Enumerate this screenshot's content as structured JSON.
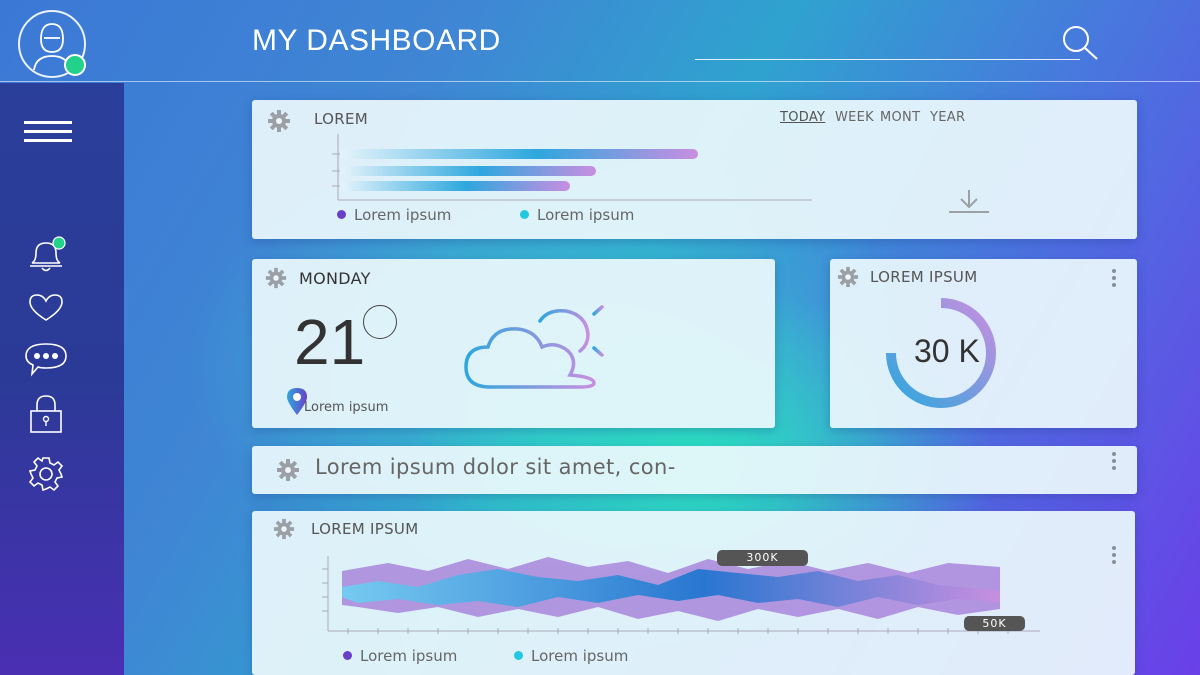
{
  "header": {
    "title": "MY DASHBOARD"
  },
  "icons": {
    "avatar": "user-avatar",
    "search": "search-icon",
    "menu": "hamburger-menu-icon",
    "notifications": "bell-icon",
    "favorites": "heart-icon",
    "messages": "chat-bubble-icon",
    "security": "lock-icon",
    "settings": "gear-icon",
    "download": "download-icon",
    "location": "location-pin-icon",
    "weather": "partly-cloudy-icon"
  },
  "colors": {
    "online_status": "#22d18a",
    "legend_purple": "#6a3fc8",
    "legend_cyan": "#22c7e0",
    "sidebar": "#2a3f9a"
  },
  "bar_card": {
    "label": "LOREM",
    "tabs": [
      {
        "label": "TODAY",
        "active": true
      },
      {
        "label": "WEEK",
        "active": false
      },
      {
        "label": "MONT",
        "active": false
      },
      {
        "label": "YEAR",
        "active": false
      }
    ],
    "legend": [
      "Lorem ipsum",
      "Lorem ipsum"
    ]
  },
  "weather_card": {
    "day": "MONDAY",
    "temperature": "21",
    "location": "Lorem ipsum"
  },
  "ring_card": {
    "label": "LOREM IPSUM",
    "value": "30 K"
  },
  "text_card": {
    "text": "Lorem ipsum dolor sit amet, con-"
  },
  "area_card": {
    "label": "LOREM IPSUM",
    "callout_high": "300K",
    "callout_low": "50K",
    "legend": [
      "Lorem ipsum",
      "Lorem ipsum"
    ]
  }
}
